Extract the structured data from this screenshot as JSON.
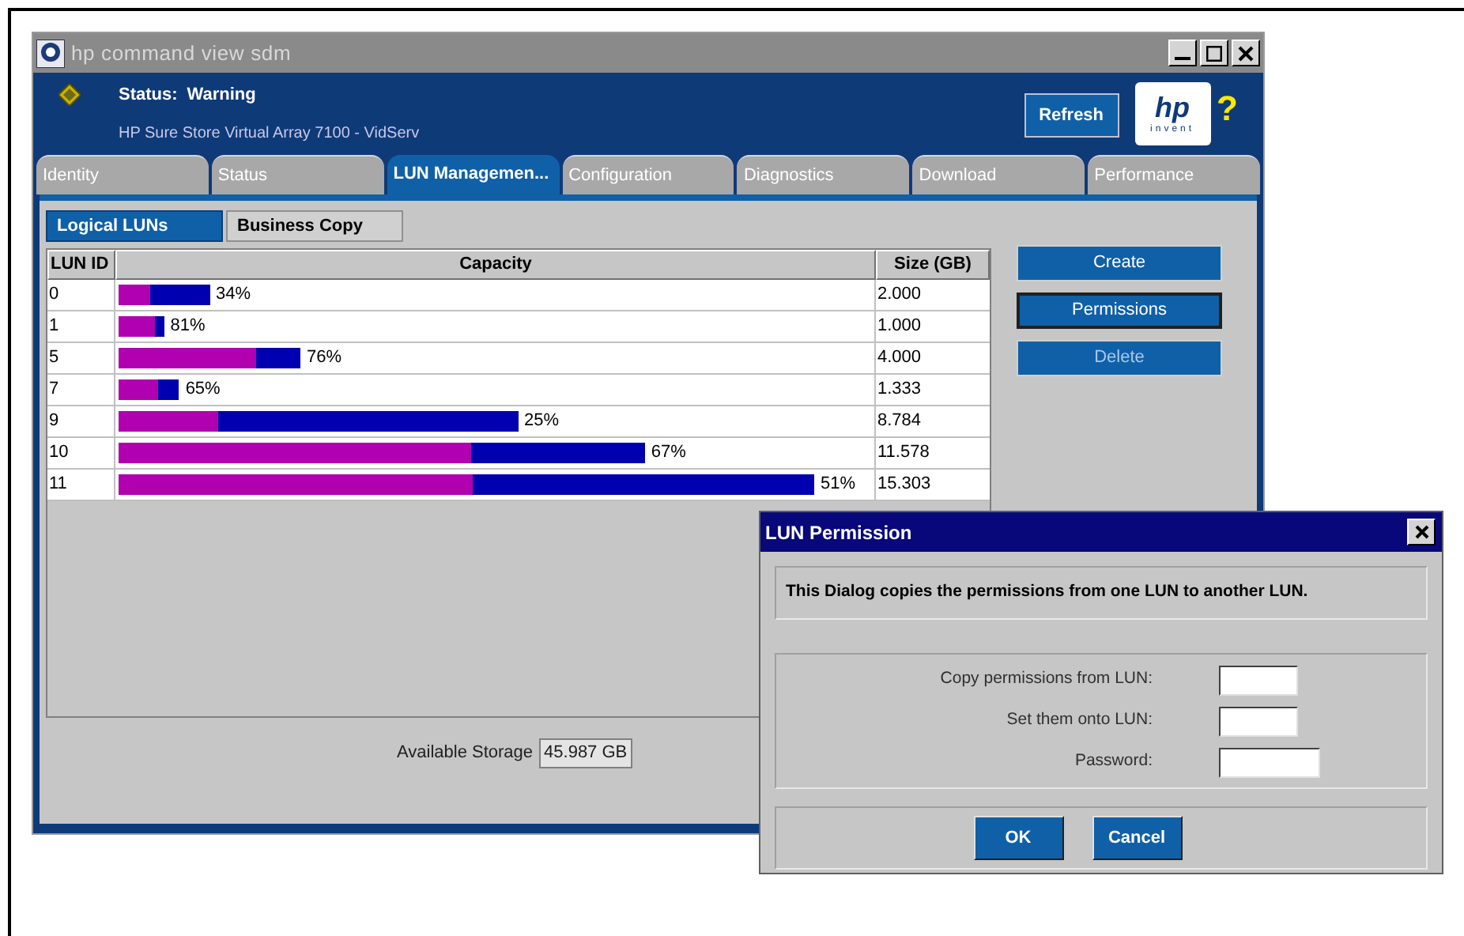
{
  "window": {
    "title": "hp command view sdm"
  },
  "header": {
    "status_label": "Status:",
    "status_value": "Warning",
    "device": "HP Sure Store Virtual Array 7100 - VidServ",
    "refresh": "Refresh",
    "logo": {
      "text": "hp",
      "tagline": "invent"
    },
    "help": "?"
  },
  "tabs": [
    {
      "label": "Identity",
      "selected": false
    },
    {
      "label": "Status",
      "selected": false
    },
    {
      "label": "LUN Managemen...",
      "selected": true
    },
    {
      "label": "Configuration",
      "selected": false
    },
    {
      "label": "Diagnostics",
      "selected": false
    },
    {
      "label": "Download",
      "selected": false
    },
    {
      "label": "Performance",
      "selected": false
    }
  ],
  "subtabs": [
    {
      "label": "Logical LUNs",
      "selected": true
    },
    {
      "label": "Business Copy",
      "selected": false
    }
  ],
  "table": {
    "columns": [
      "LUN ID",
      "Capacity",
      "Size (GB)"
    ],
    "rows": [
      {
        "lun_id": "0",
        "level": 0.34,
        "percent": "34%",
        "size": "2.000"
      },
      {
        "lun_id": "1",
        "level": 0.81,
        "percent": "81%",
        "size": "1.000"
      },
      {
        "lun_id": "5",
        "level": 0.76,
        "percent": "76%",
        "size": "4.000"
      },
      {
        "lun_id": "7",
        "level": 0.65,
        "percent": "65%",
        "size": "1.333"
      },
      {
        "lun_id": "9",
        "level": 0.25,
        "percent": "25%",
        "size": "8.784"
      },
      {
        "lun_id": "10",
        "level": 0.67,
        "percent": "67%",
        "size": "11.578"
      },
      {
        "lun_id": "11",
        "level": 0.51,
        "percent": "51%",
        "size": "15.303"
      }
    ]
  },
  "actions": [
    {
      "label": "Create",
      "disabled": false,
      "focused": false
    },
    {
      "label": "Permissions",
      "disabled": false,
      "focused": true
    },
    {
      "label": "Delete",
      "disabled": true,
      "focused": false
    }
  ],
  "available_storage": {
    "label": "Available Storage",
    "value": "45.987 GB"
  },
  "dialog": {
    "title": "LUN Permission",
    "description": "This Dialog copies the permissions from one LUN to another LUN.",
    "fields": [
      {
        "label": "Copy permissions from LUN:",
        "kind": "short"
      },
      {
        "label": "Set them onto LUN:",
        "kind": "short"
      },
      {
        "label": "Password:",
        "kind": "long"
      }
    ],
    "buttons": [
      "OK",
      "Cancel"
    ]
  }
}
